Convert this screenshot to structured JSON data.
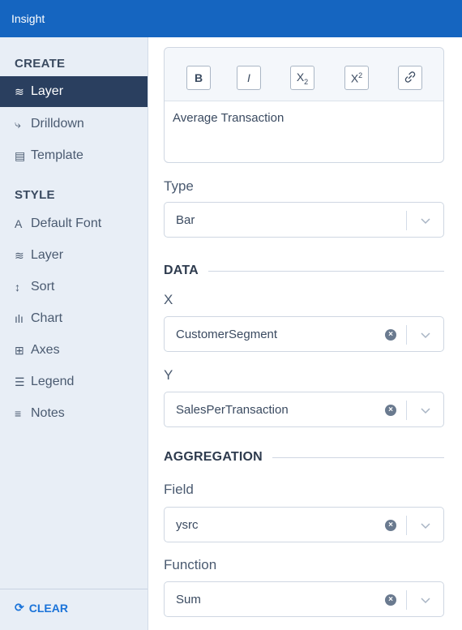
{
  "window": {
    "title": "Insight"
  },
  "sidebar": {
    "create_heading": "CREATE",
    "style_heading": "STYLE",
    "create_items": [
      {
        "label": "Layer",
        "icon": "layers-icon",
        "active": true
      },
      {
        "label": "Drilldown",
        "icon": "drilldown-icon",
        "active": false
      },
      {
        "label": "Template",
        "icon": "template-icon",
        "active": false
      }
    ],
    "style_items": [
      {
        "label": "Default Font",
        "icon": "font-icon"
      },
      {
        "label": "Layer",
        "icon": "layers-icon"
      },
      {
        "label": "Sort",
        "icon": "sort-icon"
      },
      {
        "label": "Chart",
        "icon": "chart-icon"
      },
      {
        "label": "Axes",
        "icon": "axes-icon"
      },
      {
        "label": "Legend",
        "icon": "legend-icon"
      },
      {
        "label": "Notes",
        "icon": "notes-icon"
      }
    ],
    "clear_label": "CLEAR"
  },
  "editor": {
    "toolbar": {
      "bold": "B",
      "italic": "I",
      "subscript": "X",
      "superscript": "X",
      "sub_mark": "2",
      "sup_mark": "2"
    },
    "content": "Average Transaction"
  },
  "type": {
    "label": "Type",
    "value": "Bar"
  },
  "data_section": {
    "heading": "DATA",
    "x_label": "X",
    "x_value": "CustomerSegment",
    "y_label": "Y",
    "y_value": "SalesPerTransaction"
  },
  "aggregation_section": {
    "heading": "AGGREGATION",
    "field_label": "Field",
    "field_value": "ysrc",
    "function_label": "Function",
    "function_value": "Sum"
  },
  "colors": {
    "titlebar": "#1565c0",
    "sidebar_active": "#2a3f5f",
    "accent": "#1a73d9"
  }
}
